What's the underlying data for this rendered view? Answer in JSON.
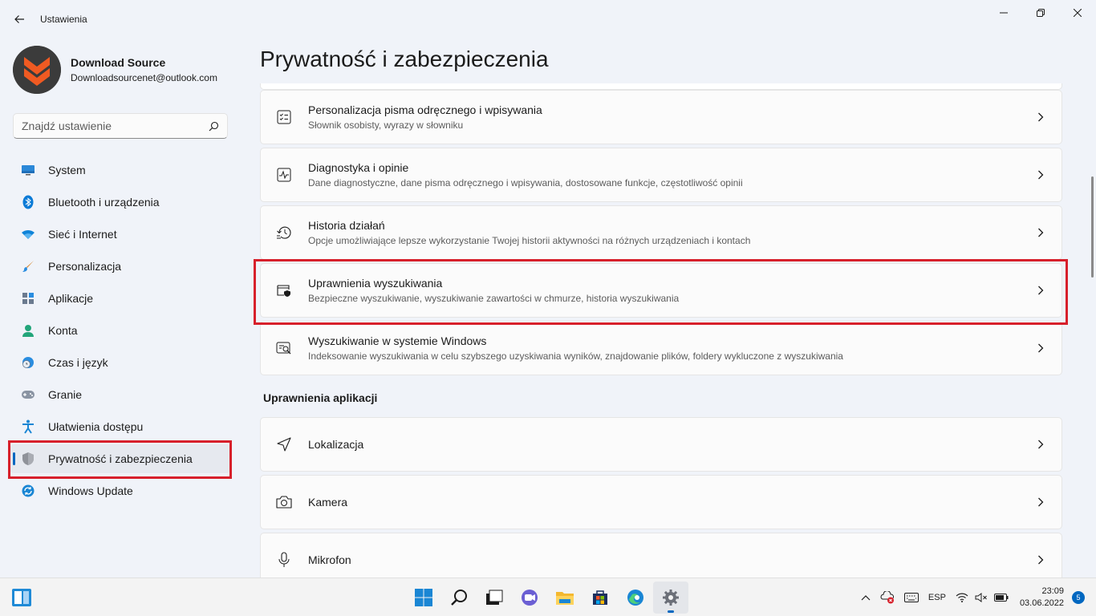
{
  "window": {
    "app_title": "Ustawienia"
  },
  "profile": {
    "name": "Download Source",
    "email": "Downloadsourcenet@outlook.com"
  },
  "search": {
    "placeholder": "Znajdź ustawienie"
  },
  "nav": {
    "items": [
      {
        "label": "System",
        "icon": "monitor-icon"
      },
      {
        "label": "Bluetooth i urządzenia",
        "icon": "bluetooth-icon"
      },
      {
        "label": "Sieć i Internet",
        "icon": "wifi-icon"
      },
      {
        "label": "Personalizacja",
        "icon": "brush-icon"
      },
      {
        "label": "Aplikacje",
        "icon": "apps-icon"
      },
      {
        "label": "Konta",
        "icon": "person-icon"
      },
      {
        "label": "Czas i język",
        "icon": "clock-globe-icon"
      },
      {
        "label": "Granie",
        "icon": "gamepad-icon"
      },
      {
        "label": "Ułatwienia dostępu",
        "icon": "accessibility-icon"
      },
      {
        "label": "Prywatność i zabezpieczenia",
        "icon": "shield-icon"
      },
      {
        "label": "Windows Update",
        "icon": "update-icon"
      }
    ],
    "active_index": 9
  },
  "main": {
    "title": "Prywatność i zabezpieczenia",
    "cards": [
      {
        "title": "Personalizacja pisma odręcznego i wpisywania",
        "subtitle": "Słownik osobisty, wyrazy w słowniku",
        "icon": "checklist-icon"
      },
      {
        "title": "Diagnostyka i opinie",
        "subtitle": "Dane diagnostyczne, dane pisma odręcznego i wpisywania, dostosowane funkcje, częstotliwość opinii",
        "icon": "pulse-icon"
      },
      {
        "title": "Historia działań",
        "subtitle": "Opcje umożliwiające lepsze wykorzystanie Twojej historii aktywności na różnych urządzeniach i kontach",
        "icon": "history-icon"
      },
      {
        "title": "Uprawnienia wyszukiwania",
        "subtitle": "Bezpieczne wyszukiwanie, wyszukiwanie zawartości w chmurze, historia wyszukiwania",
        "icon": "search-shield-icon"
      },
      {
        "title": "Wyszukiwanie w systemie Windows",
        "subtitle": "Indeksowanie wyszukiwania w celu szybszego uzyskiwania wyników, znajdowanie plików, foldery wykluczone z wyszukiwania",
        "icon": "search-window-icon"
      }
    ],
    "section_app_permissions": "Uprawnienia aplikacji",
    "app_cards": [
      {
        "title": "Lokalizacja",
        "icon": "location-icon"
      },
      {
        "title": "Kamera",
        "icon": "camera-icon"
      },
      {
        "title": "Mikrofon",
        "icon": "microphone-icon"
      }
    ]
  },
  "taskbar": {
    "language": "ESP",
    "time": "23:09",
    "date": "03.06.2022",
    "notification_count": "5"
  },
  "colors": {
    "accent": "#0067c0",
    "highlight": "#d7202b"
  }
}
